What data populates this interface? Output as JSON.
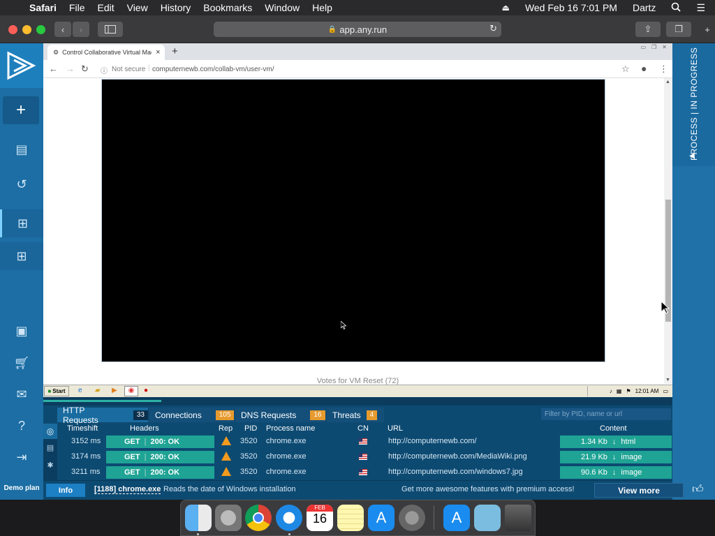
{
  "menubar": {
    "app": "Safari",
    "items": [
      "File",
      "Edit",
      "View",
      "History",
      "Bookmarks",
      "Window",
      "Help"
    ],
    "datetime": "Wed Feb 16  7:01 PM",
    "user": "Dartz"
  },
  "safari": {
    "url": "app.any.run"
  },
  "chrome": {
    "tab_title": "Control Collaborative Virtual Machine",
    "not_secure": "Not secure",
    "address": "computernewb.com/collab-vm/user-vm/",
    "votes_text": "Votes for VM Reset (72)"
  },
  "xp_taskbar": {
    "start": "Start",
    "clock": "12:01 AM"
  },
  "right_panel": {
    "status": "PROCESS | IN PROGRESS"
  },
  "sidebar": {
    "demo_plan": "Demo plan"
  },
  "bottom": {
    "tabs": [
      {
        "label": "HTTP Requests",
        "count": "33"
      },
      {
        "label": "Connections",
        "count": "105"
      },
      {
        "label": "DNS Requests",
        "count": "16"
      },
      {
        "label": "Threats",
        "count": "4"
      }
    ],
    "filter_placeholder": "Filter by PID, name or url",
    "headers": {
      "timeshift": "Timeshift",
      "headers": "Headers",
      "rep": "Rep",
      "pid": "PID",
      "process": "Process name",
      "cn": "CN",
      "url": "URL",
      "content": "Content"
    },
    "rows": [
      {
        "time": "3152 ms",
        "method": "GET",
        "status": "200: OK",
        "pid": "3520",
        "process": "chrome.exe",
        "url": "http://computernewb.com/",
        "size": "1.34 Kb",
        "type": "html"
      },
      {
        "time": "3174 ms",
        "method": "GET",
        "status": "200: OK",
        "pid": "3520",
        "process": "chrome.exe",
        "url": "http://computernewb.com/MediaWiki.png",
        "size": "21.9 Kb",
        "type": "image"
      },
      {
        "time": "3211 ms",
        "method": "GET",
        "status": "200: OK",
        "pid": "3520",
        "process": "chrome.exe",
        "url": "http://computernewb.com/windows7.jpg",
        "size": "90.6 Kb",
        "type": "image"
      }
    ]
  },
  "infobar": {
    "info_label": "Info",
    "process_tag": "[1188] chrome.exe",
    "message": "Reads the date of Windows installation",
    "promo": "Get more awesome features with premium access!",
    "view_more": "View more"
  },
  "dock": {
    "calendar_month": "FEB",
    "calendar_day": "16"
  },
  "colors": {
    "anyrun_blue": "#1c6ea4",
    "teal_pill": "#1fa394",
    "badge_orange": "#e79a2e",
    "badge_blue": "#0b2f4c"
  }
}
